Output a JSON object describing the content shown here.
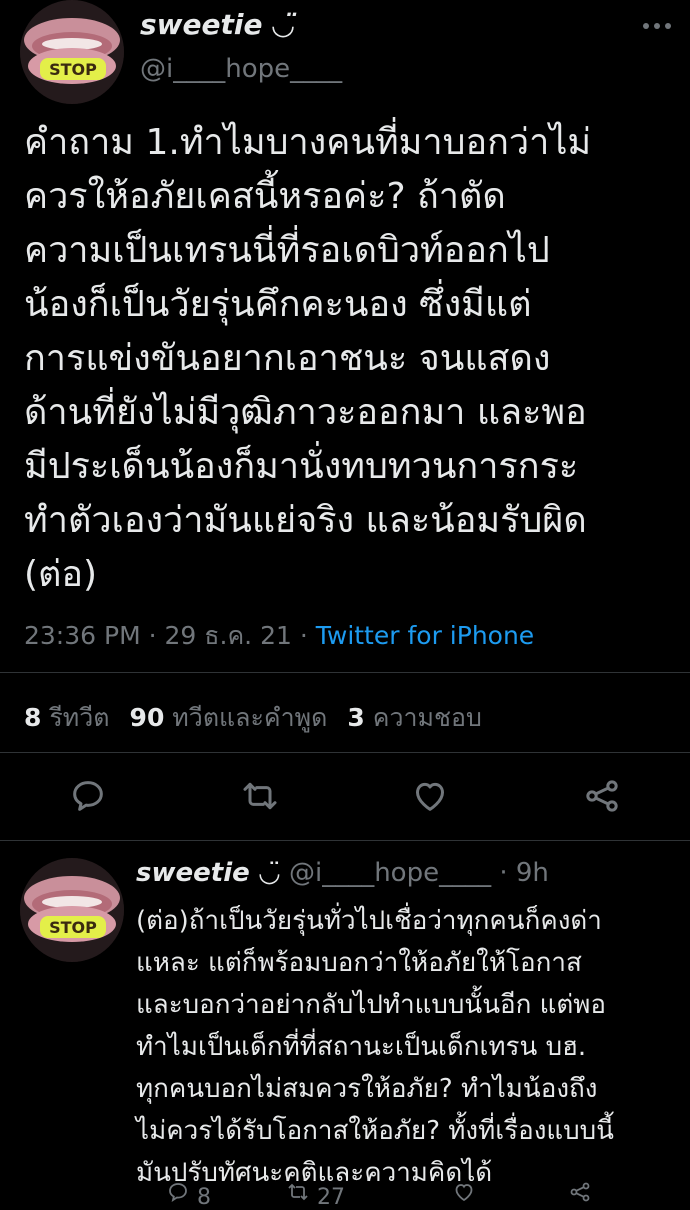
{
  "tweet": {
    "display_name": "sweetie",
    "name_emoji": "◡̈",
    "handle": "@i____hope____",
    "text_lines": [
      "คำถาม 1.ทำไมบางคนที่มาบอกว่าไม่",
      "ควรให้อภัยเคสนี้หรอค่ะ? ถ้าตัด",
      "ความเป็นเทรนนี่ที่รอเดบิวท์ออกไป",
      "น้องก็เป็นวัยรุ่นคึกคะนอง ซึ่งมีแต่",
      "การแข่งขันอยากเอาชนะ จนแสดง",
      "ด้านที่ยังไม่มีวุฒิภาวะออกมา และพอ",
      "มีประเด็นน้องก็มานั่งทบทวนการกระ",
      "ทำตัวเองว่ามันแย่จริง และน้อมรับผิด",
      "(ต่อ)"
    ],
    "time": "23:36 PM",
    "date": "29 ธ.ค. 21",
    "source": "Twitter for iPhone",
    "separator": " · ",
    "stats": {
      "retweets_count": "8",
      "retweets_label": "รีทวีต",
      "quotes_count": "90",
      "quotes_label": "ทวีตและคำพูด",
      "likes_count": "3",
      "likes_label": "ความชอบ"
    }
  },
  "reply": {
    "display_name": "sweetie",
    "name_emoji": "◡̈",
    "handle": "@i____hope____",
    "time_ago": "9h",
    "separator": " · ",
    "text_lines": [
      "(ต่อ)ถ้าเป็นวัยรุ่นทั่วไปเชื่อว่าทุกคนก็คงด่า",
      "แหละ แต่ก็พร้อมบอกว่าให้อภัยให้โอกาส",
      "และบอกว่าอย่ากลับไปทำแบบนั้นอีก แต่พอ",
      "ทำไมเป็นเด็กที่ที่สถานะเป็นเด็กเทรน บฮ.",
      "ทุกคนบอกไม่สมควรให้อภัย? ทำไมน้องถึง",
      "ไม่ควรได้รับโอกาสให้อภัย? ทั้งที่เรื่องแบบนี้",
      "มันปรับทัศนะคติและความคิดได้"
    ],
    "counts": {
      "replies": "8",
      "retweets": "27"
    }
  },
  "avatar_badge": "STOP",
  "colors": {
    "background": "#000000",
    "text": "#e7e9ea",
    "muted": "#71767b",
    "link": "#1d9bf0",
    "divider": "#2f3336"
  }
}
